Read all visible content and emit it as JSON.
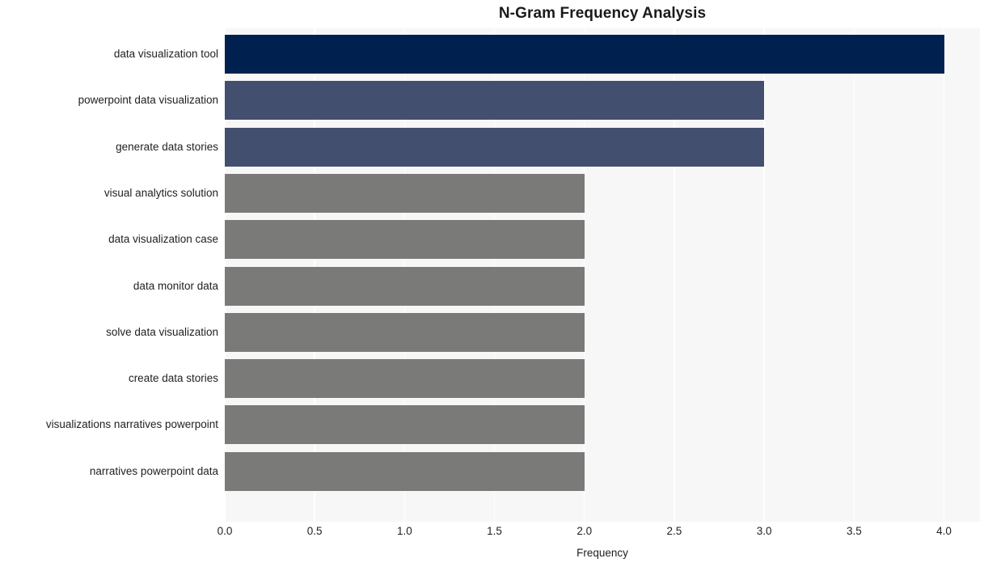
{
  "chart_data": {
    "type": "bar",
    "orientation": "horizontal",
    "title": "N-Gram Frequency Analysis",
    "xlabel": "Frequency",
    "ylabel": "",
    "categories": [
      "data visualization tool",
      "powerpoint data visualization",
      "generate data stories",
      "visual analytics solution",
      "data visualization case",
      "data monitor data",
      "solve data visualization",
      "create data stories",
      "visualizations narratives powerpoint",
      "narratives powerpoint data"
    ],
    "values": [
      4,
      3,
      3,
      2,
      2,
      2,
      2,
      2,
      2,
      2
    ],
    "bar_colors": [
      "#002150",
      "#434f6e",
      "#434f6e",
      "#7a7a78",
      "#7a7a78",
      "#7a7a78",
      "#7a7a78",
      "#7a7a78",
      "#7a7a78",
      "#7a7a78"
    ],
    "xlim": [
      0.0,
      4.2
    ],
    "xticks": [
      0.0,
      0.5,
      1.0,
      1.5,
      2.0,
      2.5,
      3.0,
      3.5,
      4.0
    ],
    "xtick_labels": [
      "0.0",
      "0.5",
      "1.0",
      "1.5",
      "2.0",
      "2.5",
      "3.0",
      "3.5",
      "4.0"
    ],
    "grid": true,
    "grid_color": "#ffffff",
    "plot_background": "#f7f7f7",
    "figure_background": "#ffffff",
    "legend": null
  }
}
